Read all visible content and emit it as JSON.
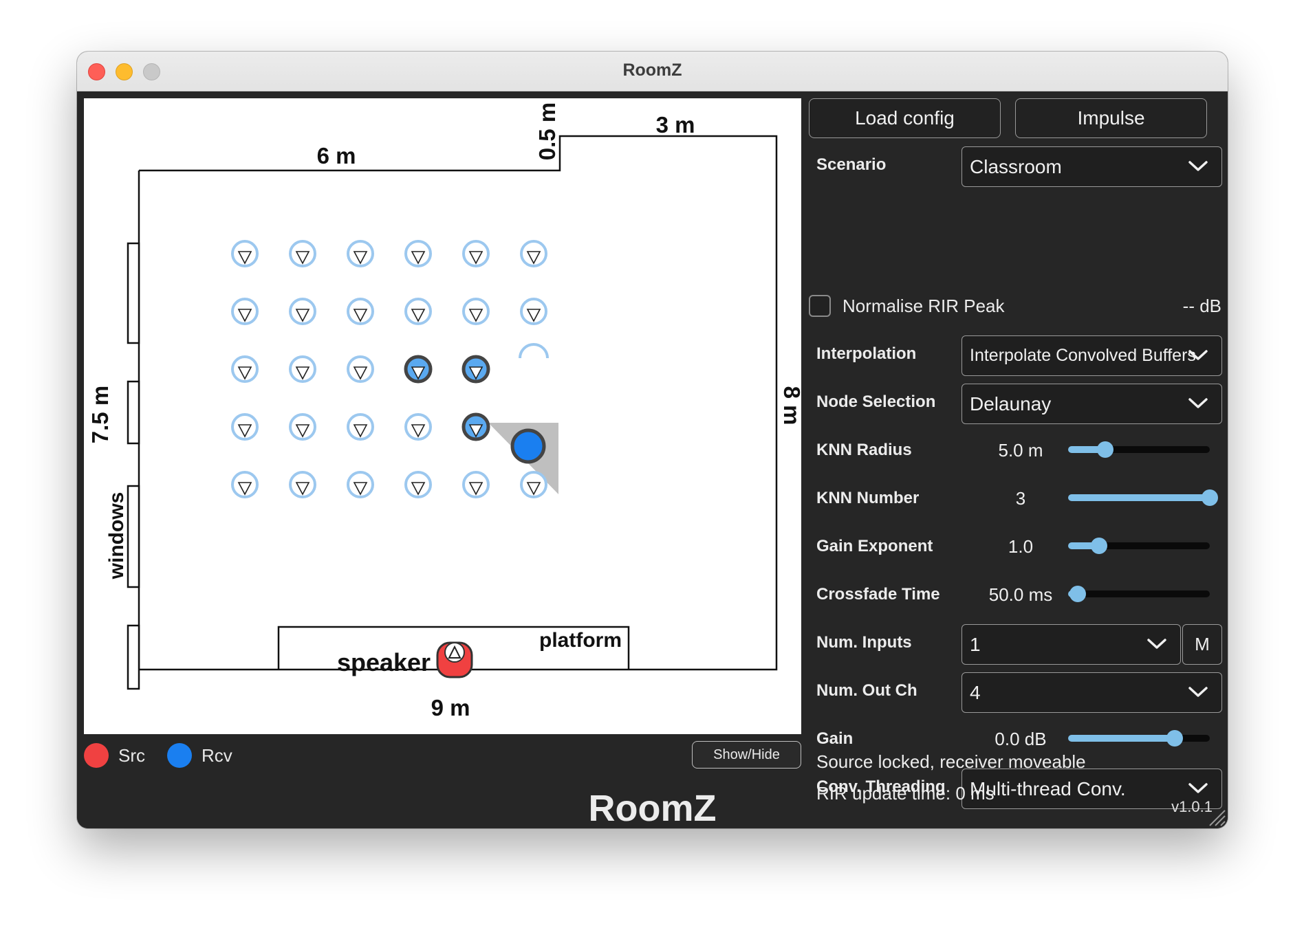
{
  "window": {
    "title": "RoomZ"
  },
  "canvas": {
    "dim_top": "6 m",
    "dim_step": "0.5 m",
    "dim_top_right": "3 m",
    "dim_left": "7.5 m",
    "dim_right": "8 m",
    "dim_bottom": "9 m",
    "windows_label": "windows",
    "platform_label": "platform",
    "speaker_label": "speaker"
  },
  "legend": {
    "src_label": "Src",
    "rcv_label": "Rcv",
    "src_color": "#f04141",
    "rcv_color": "#1a7ff0"
  },
  "show_hide_label": "Show/Hide",
  "buttons": {
    "load_config": "Load config",
    "impulse": "Impulse"
  },
  "scenario": {
    "label": "Scenario",
    "value": "Classroom"
  },
  "normalise": {
    "label": "Normalise RIR Peak",
    "checked": false,
    "peak": "-- dB"
  },
  "interpolation": {
    "label": "Interpolation",
    "value": "Interpolate Convolved Buffers"
  },
  "node_selection": {
    "label": "Node Selection",
    "value": "Delaunay"
  },
  "knn_radius": {
    "label": "KNN Radius",
    "value": "5.0 m",
    "fraction": 0.26
  },
  "knn_number": {
    "label": "KNN Number",
    "value": "3",
    "fraction": 1.0
  },
  "gain_exponent": {
    "label": "Gain Exponent",
    "value": "1.0",
    "fraction": 0.22
  },
  "crossfade_time": {
    "label": "Crossfade Time",
    "value": "50.0 ms",
    "fraction": 0.07
  },
  "num_inputs": {
    "label": "Num. Inputs",
    "value": "1",
    "m_button": "M"
  },
  "num_out_ch": {
    "label": "Num. Out Ch",
    "value": "4"
  },
  "gain": {
    "label": "Gain",
    "value": "0.0 dB",
    "fraction": 0.75
  },
  "conv_threading": {
    "label": "Conv. Threading",
    "value": "Multi-thread Conv."
  },
  "status": {
    "rir_update": "RIR update time: 0 ms",
    "lock_state": "Source locked, receiver moveable"
  },
  "footer": {
    "title": "RoomZ",
    "version": "v1.0.1"
  },
  "accent_color": "#7fbfe8"
}
